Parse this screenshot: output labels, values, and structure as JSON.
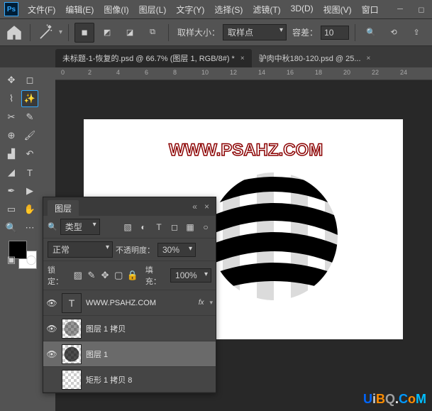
{
  "menu": {
    "file": "文件(F)",
    "edit": "编辑(E)",
    "image": "图像(I)",
    "layer": "图层(L)",
    "type": "文字(Y)",
    "select": "选择(S)",
    "filter": "滤镜(T)",
    "3d": "3D(D)",
    "view": "视图(V)",
    "window": "窗口"
  },
  "options": {
    "sample_label": "取样大小：",
    "sample_value": "取样点",
    "tolerance_label": "容差：",
    "tolerance_value": "10"
  },
  "tabs": {
    "t1": "未标题-1-恢复的.psd @ 66.7% (图层 1, RGB/8#) *",
    "t2": "驴肉中秋180-120.psd @ 25..."
  },
  "ruler": [
    "0",
    "2",
    "4",
    "6",
    "8",
    "10",
    "12",
    "14",
    "16",
    "18",
    "20",
    "22",
    "24"
  ],
  "canvas": {
    "watermark": "WWW.PSAHZ.COM"
  },
  "panel": {
    "title": "图层",
    "kind_label": "类型",
    "blend": "正常",
    "opacity_label": "不透明度：",
    "opacity_value": "30%",
    "lock_label": "锁定：",
    "fill_label": "填充：",
    "fill_value": "100%",
    "layers": [
      {
        "vis": "👁",
        "name": "WWW.PSAHZ.COM",
        "fx": "fx",
        "type": "T"
      },
      {
        "vis": "👁",
        "name": "图层 1 拷贝",
        "type": "img"
      },
      {
        "vis": "👁",
        "name": "图层 1",
        "type": "img",
        "selected": true
      },
      {
        "vis": "",
        "name": "矩形 1 拷贝 8",
        "type": "shape"
      }
    ]
  },
  "brand": {
    "u": "U",
    "i": "i",
    "b": "B",
    "q": "Q",
    "dot": ".",
    "c": "C",
    "o": "o",
    "m": "M"
  }
}
